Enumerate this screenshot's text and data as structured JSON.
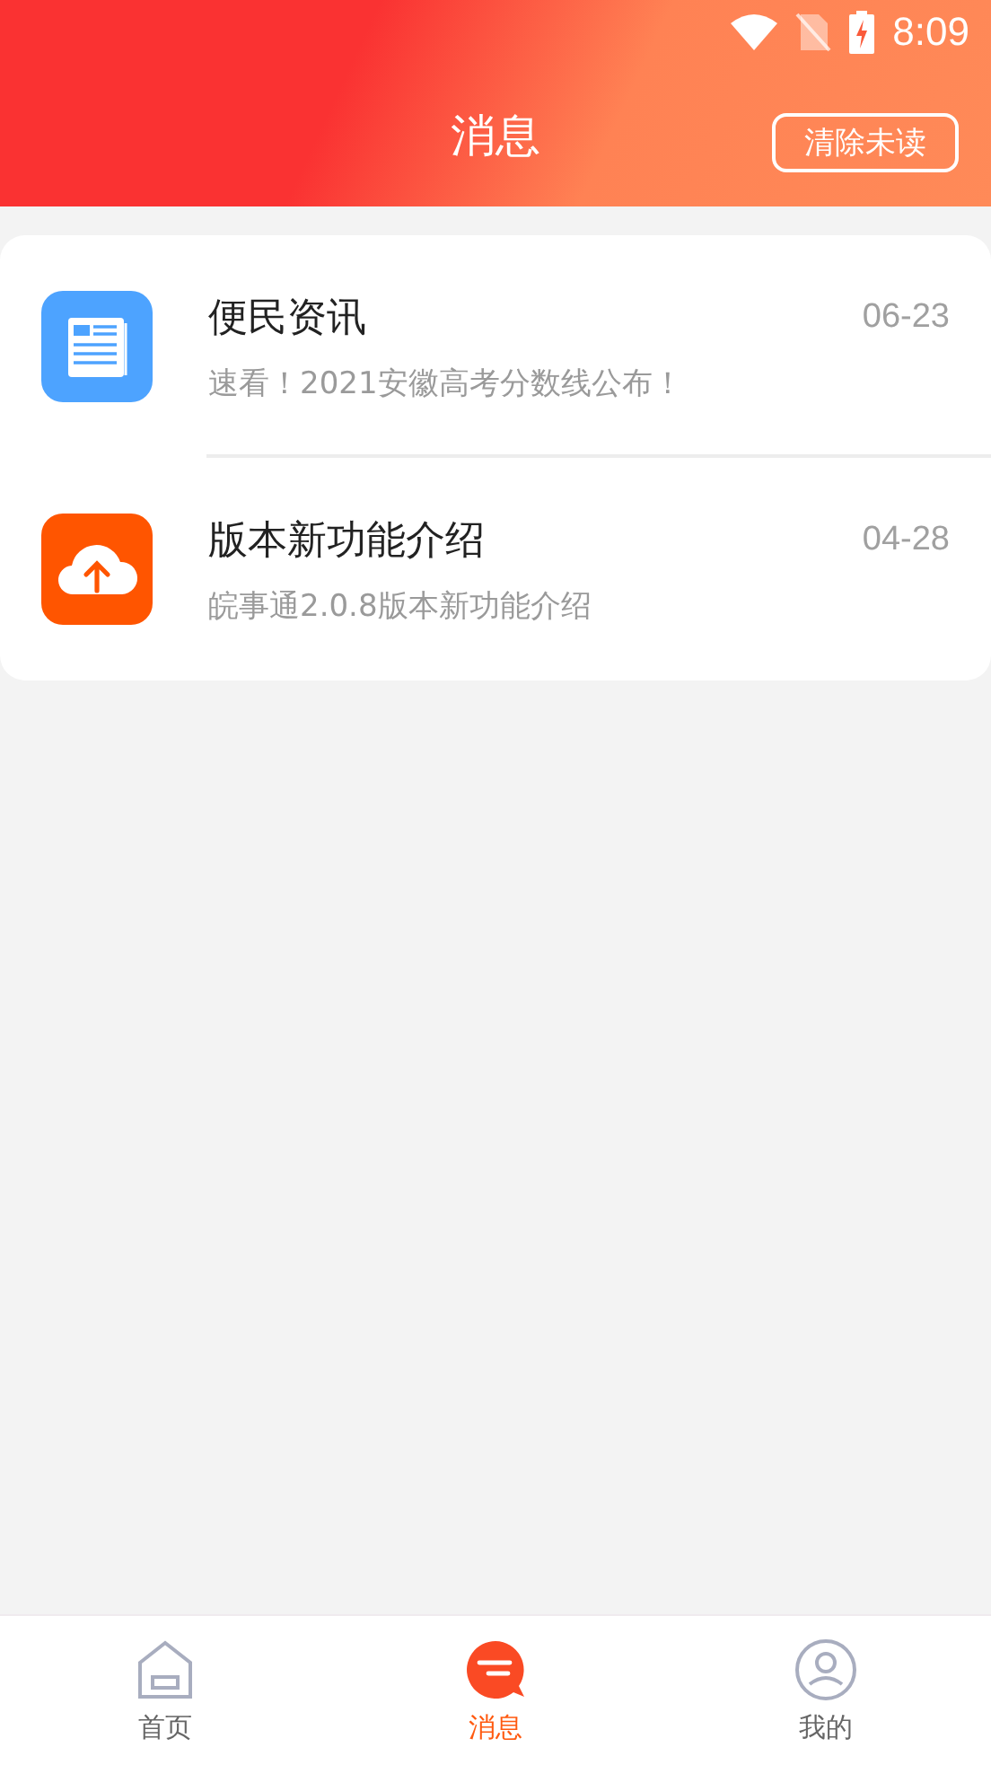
{
  "status_bar": {
    "time": "8:09"
  },
  "header": {
    "title": "消息",
    "action": "清除未读"
  },
  "messages": [
    {
      "kind": "news",
      "title": "便民资讯",
      "preview": "速看！2021安徽高考分数线公布！",
      "date": "06-23"
    },
    {
      "kind": "update",
      "title": "版本新功能介绍",
      "preview": "皖事通2.0.8版本新功能介绍",
      "date": "04-28"
    }
  ],
  "tabs": [
    {
      "kind": "home",
      "label": "首页",
      "selected": false
    },
    {
      "kind": "messages",
      "label": "消息",
      "selected": true
    },
    {
      "kind": "profile",
      "label": "我的",
      "selected": false
    }
  ]
}
